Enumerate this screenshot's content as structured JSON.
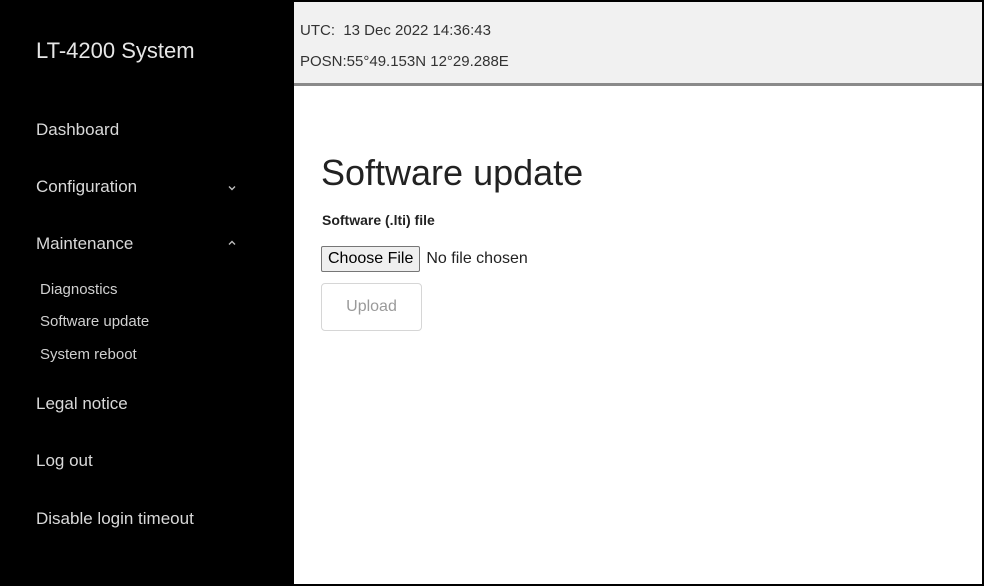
{
  "sidebar": {
    "brand": "LT-4200 System",
    "items": [
      {
        "label": "Dashboard"
      },
      {
        "label": "Configuration",
        "chevron": "chevron-down-icon"
      },
      {
        "label": "Maintenance",
        "chevron": "chevron-up-icon",
        "children": [
          {
            "label": "Diagnostics"
          },
          {
            "label": "Software update"
          },
          {
            "label": "System reboot"
          }
        ]
      },
      {
        "label": "Legal notice"
      },
      {
        "label": "Log out"
      },
      {
        "label": "Disable login timeout"
      }
    ]
  },
  "status": {
    "utc_line": "UTC:  13 Dec 2022 14:36:43",
    "position_line": "POSN:55°49.153N 12°29.288E"
  },
  "main": {
    "title": "Software update",
    "file_label": "Software (.lti) file",
    "choose_button": "Choose File",
    "no_file_text": "No file chosen",
    "upload_button": "Upload"
  },
  "colors": {
    "sidebar_bg": "#000000",
    "topbar_bg": "#f1f1f1",
    "topbar_border": "#8a8a8a"
  }
}
